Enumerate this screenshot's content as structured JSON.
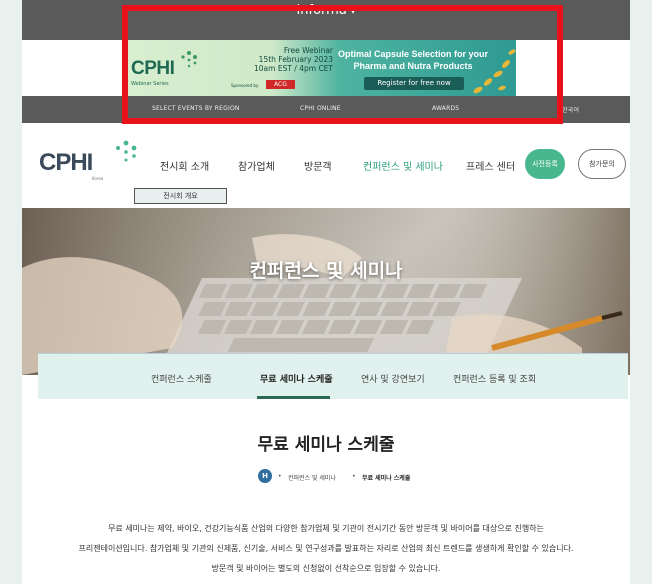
{
  "topbar": {
    "brand": "informa",
    "caret": "▾"
  },
  "ad": {
    "logo": "CPHI",
    "logo_sub": "Webinar Series",
    "webinar_line1": "Free Webinar",
    "webinar_line2": "15th February 2023",
    "webinar_line3": "10am EST / 4pm CET",
    "sponsor_label": "Sponsored by",
    "sponsor": "ACG",
    "headline_line1": "Optimal Capsule Selection for your",
    "headline_line2": "Pharma and Nutra Products",
    "cta": "Register for free now"
  },
  "region_bar": {
    "items": [
      "SELECT EVENTS BY REGION",
      "CPHI ONLINE",
      "AWARDS",
      "한국어"
    ]
  },
  "header": {
    "logo": "CPHI",
    "logo_sub": "Korea",
    "nav": [
      "전시회 소개",
      "참가업체",
      "방문객",
      "컨퍼런스 및 세미나",
      "프레스 센터"
    ],
    "btn_primary": "사전등록",
    "btn_outline": "참가문의",
    "submenu": "전시회 개요"
  },
  "hero": {
    "title": "컨퍼런스 및 세미나"
  },
  "tabs": [
    "컨퍼런스 스케줄",
    "무료 세미나 스케줄",
    "연사 및 강연보기",
    "컨퍼런스 등록 및 조회"
  ],
  "content": {
    "title": "무료 세미나 스케줄",
    "breadcrumb_home": "H",
    "breadcrumb_1": "컨퍼런스 및 세미나",
    "breadcrumb_2": "무료 세미나 스케줄",
    "para1": "무료 세미나는 제약, 바이오, 건강기능식품 산업의 다양한 참가업체 및 기관이 전시기간 동안 방문객 및 바이어를 대상으로 진행하는",
    "para2": "프리젠테이션입니다. 참가업체 및 기관의 신제품, 신기술, 서비스 및 연구성과를 발표하는 자리로 산업의 최신 트렌드를 생생하게 확인할 수 있습니다.",
    "para3": "방문객 및 바이어는 별도의 신청없이 선착순으로 입장할 수 있습니다."
  },
  "colors": {
    "accent": "#49b78e",
    "highlight": "#e8131a",
    "dark_bar": "#5a5a5a"
  }
}
